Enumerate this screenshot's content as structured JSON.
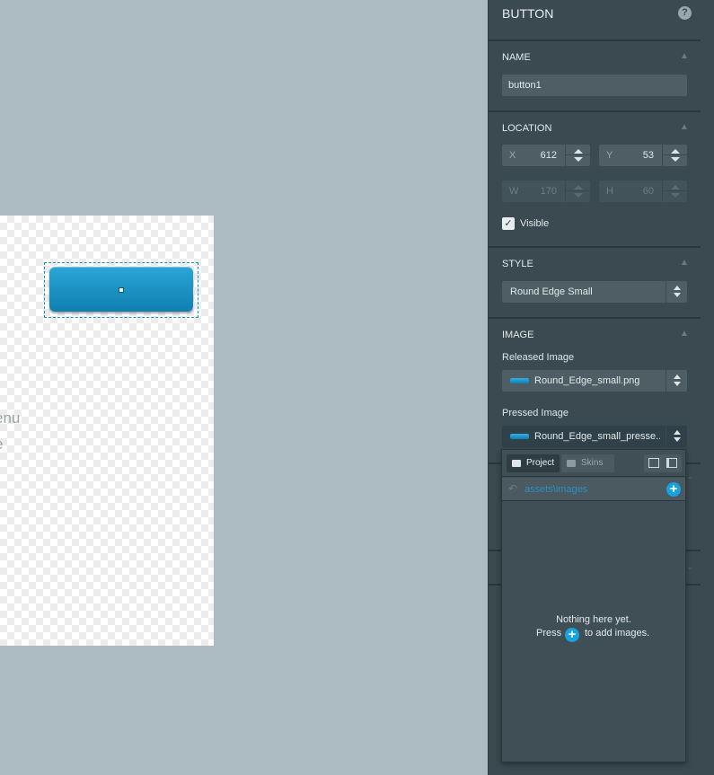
{
  "canvas": {
    "partial_text_1": "enu",
    "partial_text_2": "e"
  },
  "panel": {
    "title": "BUTTON",
    "help_icon": "?",
    "name_section": {
      "title": "NAME",
      "value": "button1"
    },
    "location_section": {
      "title": "LOCATION",
      "x_label": "X",
      "x_value": "612",
      "y_label": "Y",
      "y_value": "53",
      "w_label": "W",
      "w_value": "170",
      "h_label": "H",
      "h_value": "60",
      "visible_label": "Visible",
      "visible_checked": true
    },
    "style_section": {
      "title": "STYLE",
      "value": "Round Edge Small"
    },
    "image_section": {
      "title": "IMAGE",
      "released_label": "Released Image",
      "released_value": "Round_Edge_small.png",
      "pressed_label": "Pressed Image",
      "pressed_value": "Round_Edge_small_presse..."
    }
  },
  "picker": {
    "tab_project": "Project",
    "tab_skins": "Skins",
    "path": "assets\\images",
    "empty_line1": "Nothing here yet.",
    "empty_press": "Press",
    "empty_suffix": "to add images."
  },
  "colors": {
    "accent": "#16a3e0",
    "panel_bg": "#3b4a50",
    "workspace_bg": "#adbcc3",
    "button_widget": "#1a8fc2"
  }
}
